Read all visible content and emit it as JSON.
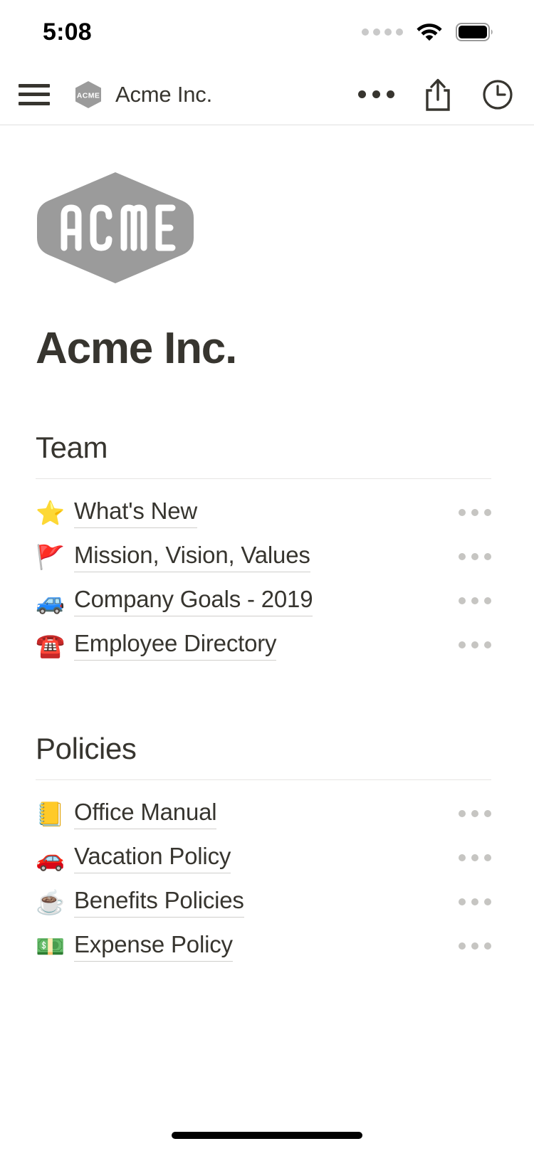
{
  "status_bar": {
    "time": "5:08",
    "cellular_icon": "cellular-dots-icon",
    "wifi_icon": "wifi-icon",
    "battery_icon": "battery-full-icon"
  },
  "nav_bar": {
    "menu_icon": "hamburger-menu-icon",
    "workspace_badge": "acme-badge-icon",
    "title": "Acme Inc.",
    "more_icon": "more-horizontal-icon",
    "share_icon": "share-icon",
    "history_icon": "clock-history-icon"
  },
  "page": {
    "logo_alt": "ACME",
    "logo_text": "ACME",
    "title": "Acme Inc."
  },
  "sections": [
    {
      "heading": "Team",
      "items": [
        {
          "emoji": "⭐",
          "emoji_name": "star-emoji",
          "label": "What's New",
          "menu_icon": "row-more-icon"
        },
        {
          "emoji": "🚩",
          "emoji_name": "triangular-flag-emoji",
          "label": "Mission, Vision, Values",
          "menu_icon": "row-more-icon"
        },
        {
          "emoji": "🚙",
          "emoji_name": "blue-suv-emoji",
          "label": "Company Goals - 2019",
          "menu_icon": "row-more-icon"
        },
        {
          "emoji": "☎️",
          "emoji_name": "telephone-emoji",
          "label": "Employee Directory",
          "menu_icon": "row-more-icon"
        }
      ]
    },
    {
      "heading": "Policies",
      "items": [
        {
          "emoji": "📒",
          "emoji_name": "ledger-notebook-emoji",
          "label": "Office Manual",
          "menu_icon": "row-more-icon"
        },
        {
          "emoji": "🚗",
          "emoji_name": "red-car-emoji",
          "label": "Vacation Policy",
          "menu_icon": "row-more-icon"
        },
        {
          "emoji": "☕",
          "emoji_name": "hot-beverage-emoji",
          "label": "Benefits Policies",
          "menu_icon": "row-more-icon"
        },
        {
          "emoji": "💵",
          "emoji_name": "dollar-banknote-emoji",
          "label": "Expense Policy",
          "menu_icon": "row-more-icon"
        }
      ]
    }
  ],
  "colors": {
    "text_primary": "#37352f",
    "logo_gray": "#9b9b9b",
    "divider": "#e6e5e3",
    "row_underline": "#cfcecb",
    "row_dots": "#c6c5c2"
  },
  "home_indicator": "home-indicator"
}
